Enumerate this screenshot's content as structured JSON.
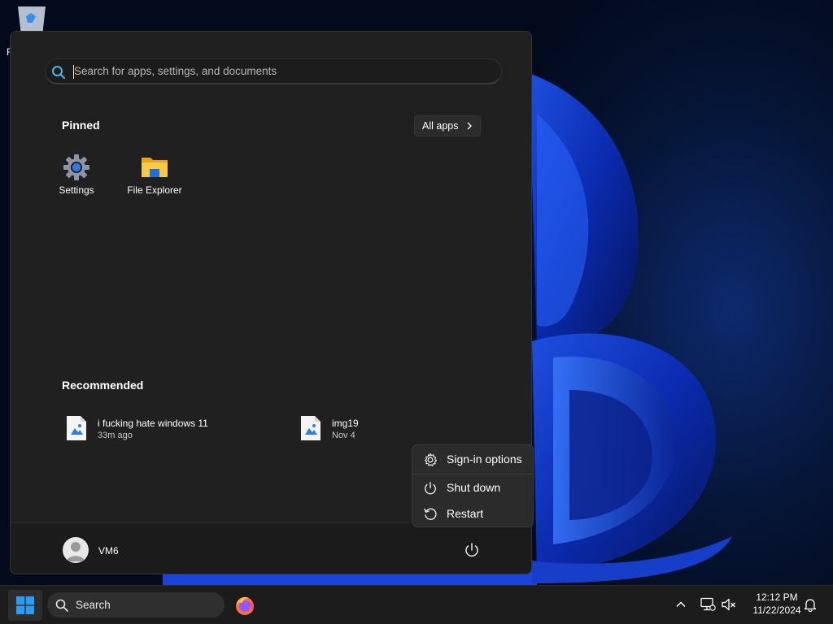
{
  "start_menu": {
    "search_placeholder": "Search for apps, settings, and documents",
    "pinned_title": "Pinned",
    "all_apps_label": "All apps",
    "pinned_apps": [
      {
        "label": "Settings",
        "icon": "settings-gear-icon"
      },
      {
        "label": "File Explorer",
        "icon": "folder-icon"
      }
    ],
    "recommended_title": "Recommended",
    "recommended": [
      {
        "name": "i fucking hate windows 11",
        "time": "33m ago",
        "icon": "image-file-icon"
      },
      {
        "name": "img19",
        "time": "Nov 4",
        "icon": "image-file-icon"
      }
    ],
    "user_name": "VM6"
  },
  "power_menu": {
    "items": [
      {
        "label": "Sign-in options",
        "icon": "gear-icon"
      },
      {
        "label": "Shut down",
        "icon": "power-icon"
      },
      {
        "label": "Restart",
        "icon": "restart-icon"
      }
    ]
  },
  "taskbar": {
    "search_label": "Search",
    "clock_time": "12:12 PM",
    "clock_date": "11/22/2024"
  },
  "colors": {
    "accent": "#0078d4",
    "menu_bg": "#202020",
    "taskbar_bg": "#1c1c1c"
  }
}
